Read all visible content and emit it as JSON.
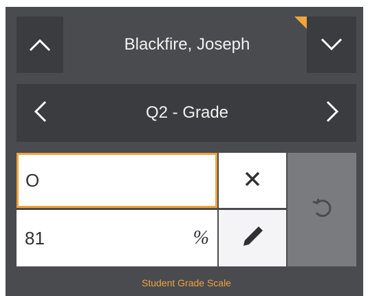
{
  "student": {
    "name": "Blackfire, Joseph",
    "prev_icon": "chevron-up-icon",
    "next_icon": "chevron-down-icon"
  },
  "period": {
    "label": "Q2 - Grade",
    "prev_icon": "chevron-left-icon",
    "next_icon": "chevron-right-icon"
  },
  "grade": {
    "letter_value": "O",
    "percent_value": "81",
    "percent_symbol": "%"
  },
  "footer": {
    "label": "Student Grade Scale"
  },
  "colors": {
    "accent": "#f0a43a",
    "panel": "#4a4b4f",
    "dark_cell": "#3b3c40"
  }
}
